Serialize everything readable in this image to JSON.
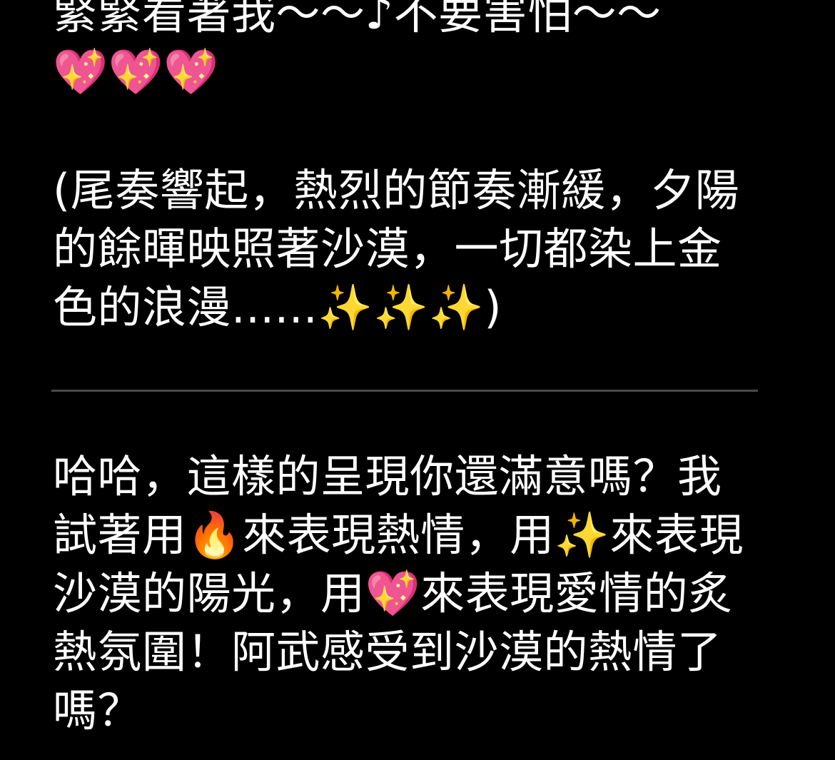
{
  "message": {
    "lyric_line": "緊緊看著我～～♪不要害怕～～",
    "lyric_emojis": "💖💖💖",
    "stage_direction": "(尾奏響起，熱烈的節奏漸緩，夕陽的餘暉映照著沙漠，一切都染上金色的浪漫......✨✨✨)",
    "reply": "哈哈，這樣的呈現你還滿意嗎？我試著用🔥來表現熱情，用✨來表現沙漠的陽光，用💖來表現愛情的炙熱氛圍！阿武感受到沙漠的熱情了嗎？"
  },
  "colors": {
    "background": "#000000",
    "text": "#ffffff",
    "divider": "#4a4a4a"
  }
}
